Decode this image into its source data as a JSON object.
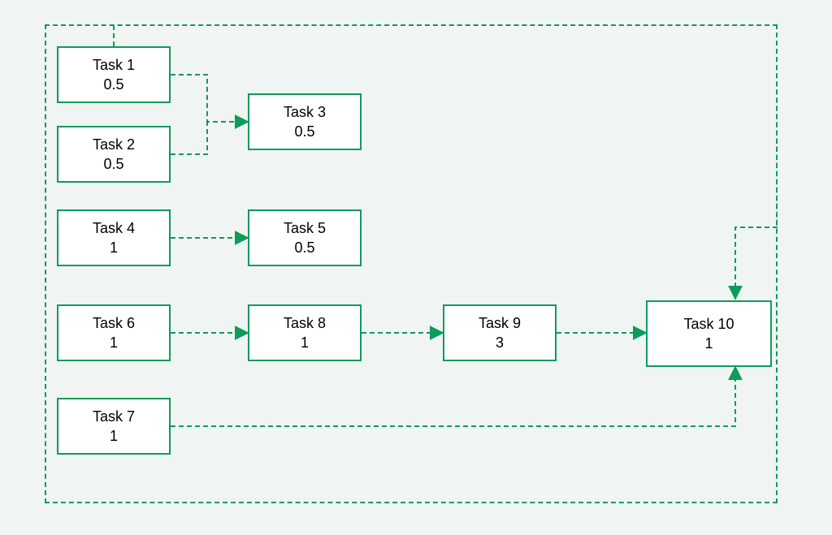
{
  "diagram": {
    "nodes": {
      "t1": {
        "label": "Task 1",
        "value": "0.5"
      },
      "t2": {
        "label": "Task 2",
        "value": "0.5"
      },
      "t3": {
        "label": "Task 3",
        "value": "0.5"
      },
      "t4": {
        "label": "Task 4",
        "value": "1"
      },
      "t5": {
        "label": "Task 5",
        "value": "0.5"
      },
      "t6": {
        "label": "Task 6",
        "value": "1"
      },
      "t7": {
        "label": "Task 7",
        "value": "1"
      },
      "t8": {
        "label": "Task 8",
        "value": "1"
      },
      "t9": {
        "label": "Task 9",
        "value": "3"
      },
      "t10": {
        "label": "Task 10",
        "value": "1"
      }
    },
    "edges": [
      [
        "t1",
        "t3"
      ],
      [
        "t2",
        "t3"
      ],
      [
        "t4",
        "t5"
      ],
      [
        "t6",
        "t8"
      ],
      [
        "t8",
        "t9"
      ],
      [
        "t9",
        "t10"
      ],
      [
        "t7",
        "t10"
      ],
      [
        "t1",
        "t10"
      ]
    ]
  }
}
